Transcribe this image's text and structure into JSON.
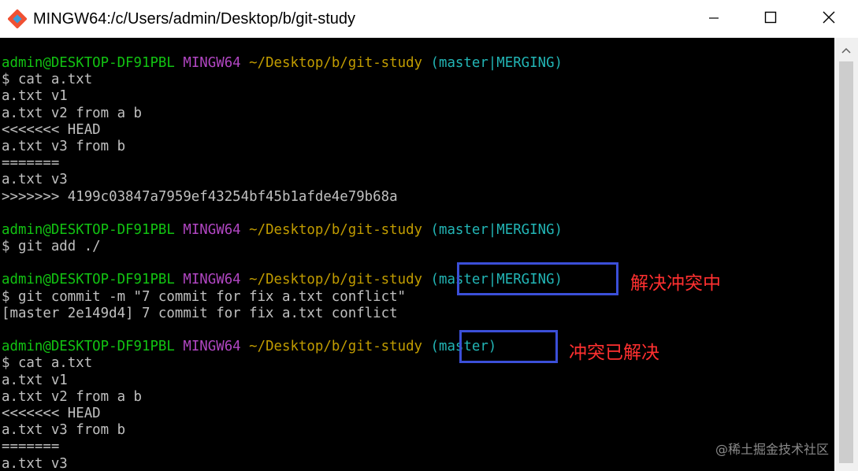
{
  "window": {
    "title": "MINGW64:/c/Users/admin/Desktop/b/git-study"
  },
  "terminal": {
    "prompt_user": "admin@DESKTOP-DF91PBL",
    "prompt_env": "MINGW64",
    "prompt_path": "~/Desktop/b/git-study",
    "lines": [
      {
        "type": "prompt",
        "branch": "(master|MERGING)"
      },
      {
        "type": "text",
        "text": "$ cat a.txt"
      },
      {
        "type": "text",
        "text": "a.txt v1"
      },
      {
        "type": "text",
        "text": "a.txt v2 from a b"
      },
      {
        "type": "text",
        "text": "<<<<<<< HEAD"
      },
      {
        "type": "text",
        "text": "a.txt v3 from b"
      },
      {
        "type": "text",
        "text": "======="
      },
      {
        "type": "text",
        "text": "a.txt v3"
      },
      {
        "type": "text",
        "text": ">>>>>>> 4199c03847a7959ef43254bf45b1afde4e79b68a"
      },
      {
        "type": "blank",
        "text": ""
      },
      {
        "type": "prompt",
        "branch": "(master|MERGING)"
      },
      {
        "type": "text",
        "text": "$ git add ./"
      },
      {
        "type": "blank",
        "text": ""
      },
      {
        "type": "prompt",
        "branch": "(master|MERGING)"
      },
      {
        "type": "text",
        "text": "$ git commit -m \"7 commit for fix a.txt conflict\""
      },
      {
        "type": "text",
        "text": "[master 2e149d4] 7 commit for fix a.txt conflict"
      },
      {
        "type": "blank",
        "text": ""
      },
      {
        "type": "prompt",
        "branch": "(master)"
      },
      {
        "type": "text",
        "text": "$ cat a.txt"
      },
      {
        "type": "text",
        "text": "a.txt v1"
      },
      {
        "type": "text",
        "text": "a.txt v2 from a b"
      },
      {
        "type": "text",
        "text": "<<<<<<< HEAD"
      },
      {
        "type": "text",
        "text": "a.txt v3 from b"
      },
      {
        "type": "text",
        "text": "======="
      },
      {
        "type": "text",
        "text": "a.txt v3"
      }
    ]
  },
  "annotations": {
    "note1": "解决冲突中",
    "note2": "冲突已解决"
  },
  "watermark": "@稀土掘金技术社区",
  "colors": {
    "terminal_bg": "#000000",
    "text": "#c0c0c0",
    "user": "#12c312",
    "env": "#b146c2",
    "path": "#c19c00",
    "branch": "#22b5b5",
    "highlight_box": "#3b4fd8",
    "annotation": "#ff3030"
  }
}
